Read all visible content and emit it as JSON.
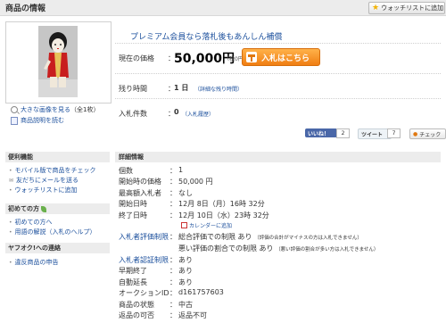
{
  "header": {
    "title": "商品の情報",
    "watchlist_button": "ウォッチリストに追加"
  },
  "image": {
    "enlarge_link": "大きな画像を見る",
    "enlarge_count": "（全1枚）",
    "description_link": "商品説明を読む"
  },
  "promo": "プレミアム会員なら落札後もあんしん補償",
  "price": {
    "label": "現在の価格",
    "colon": "：",
    "value": "50,000円",
    "tax": "（税0円）",
    "bid_button": "入札はこちら"
  },
  "time": {
    "label": "残り時間",
    "colon": "：",
    "value": "1 日",
    "detail_link": "（詳細な残り時間）"
  },
  "bids": {
    "label": "入札件数",
    "colon": "：",
    "value": "0",
    "history_link": "（入札履歴）"
  },
  "social": {
    "fb_label": "いいね！",
    "fb_count": "2",
    "tw_label": "ツイート",
    "tw_count": "7",
    "check_label": "チェック"
  },
  "sidebar": {
    "sections": [
      {
        "title": "便利機能",
        "items": [
          "モバイル版で商品をチェック",
          "友だちにメールを送る",
          "ウォッチリストに追加"
        ]
      },
      {
        "title": "初めての方",
        "items": [
          "初めての方へ",
          "用語の解説（入札のヘルプ）"
        ]
      },
      {
        "title": "ヤフオク!への連絡",
        "items": [
          "違反商品の申告"
        ]
      }
    ]
  },
  "details": {
    "title": "詳細情報",
    "rows": [
      {
        "label": "個数",
        "value": "1"
      },
      {
        "label": "開始時の価格",
        "value": "50,000 円"
      },
      {
        "label": "最高額入札者",
        "value": "なし"
      },
      {
        "label": "開始日時",
        "value": "12月 8日（月）16時 32分"
      },
      {
        "label": "終了日時",
        "value": "12月 10日（水）23時 32分"
      },
      {
        "label": "入札者評価制限",
        "value": "総合評価での制限 あり",
        "note": "（評価の合計がマイナスの方は入札できません）"
      },
      {
        "label": "",
        "value": "悪い評価の割合での制限 あり",
        "note": "（悪い評価の割合が多い方は入札できません）"
      },
      {
        "label": "入札者認証制限",
        "value": "あり"
      },
      {
        "label": "早期終了",
        "value": "あり"
      },
      {
        "label": "自動延長",
        "value": "あり"
      },
      {
        "label": "オークションID",
        "value": "d161757603"
      },
      {
        "label": "商品の状態",
        "value": "中古"
      },
      {
        "label": "返品の可否",
        "value": "返品不可"
      }
    ],
    "calendar_link": "カレンダーに追加",
    "colon": "："
  },
  "icons": [
    "star-icon",
    "zoom-icon",
    "document-icon",
    "hammer-icon",
    "calendar-icon",
    "leaf-icon",
    "mobile-icon",
    "mail-icon"
  ],
  "colors": {
    "link": "#1b4f9c",
    "bid_button": "#f07e12",
    "facebook": "#4a67a8",
    "section_bg": "#ececec"
  }
}
